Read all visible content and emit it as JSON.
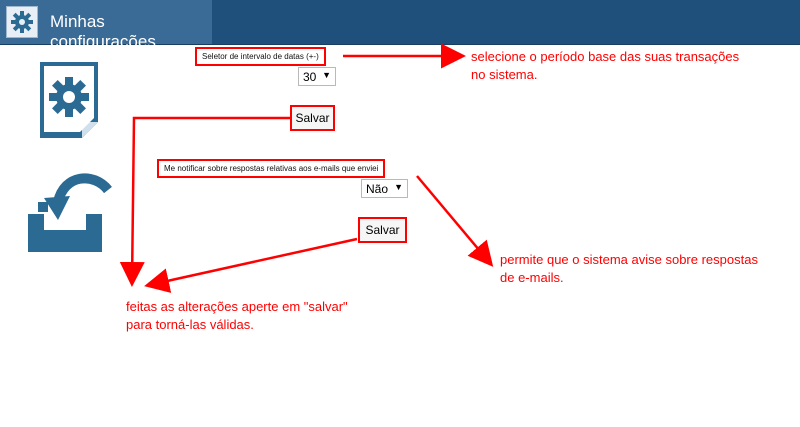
{
  "header": {
    "title": "Minhas configurações",
    "icon": "gear-icon"
  },
  "sidebar": {
    "items": [
      {
        "icon": "settings-document-icon"
      },
      {
        "icon": "inbox-return-icon"
      }
    ]
  },
  "date_range": {
    "label": "Seletor de intervalo de datas (+-)",
    "value": "30",
    "save_label": "Salvar"
  },
  "notify_replies": {
    "label": "Me notificar sobre respostas relativas aos e-mails que enviei",
    "value": "Não",
    "save_label": "Salvar"
  },
  "annotations": {
    "date_range_help": [
      "selecione o período base das suas transações",
      "no sistema."
    ],
    "notify_help": [
      "permite que o sistema avise sobre respostas",
      "de e-mails."
    ],
    "save_help": [
      "feitas as alterações aperte em \"salvar\"",
      "para torná-las válidas."
    ]
  },
  "colors": {
    "header_bg": "#1f4f7b",
    "header_tab_bg": "#3a6b96",
    "icon_blue": "#2b6a93",
    "annotation_red": "#ff0000"
  }
}
